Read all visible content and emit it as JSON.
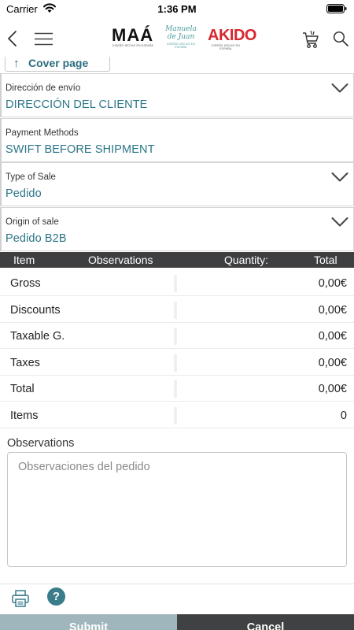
{
  "status_bar": {
    "carrier": "Carrier",
    "time": "1:36 PM"
  },
  "header": {
    "logos": {
      "maa": {
        "text": "MAÁ",
        "sub": "DISEÑO HECHO EN ESPAÑA"
      },
      "manuela": {
        "text_line1": "Manuela",
        "text_line2": "de Juan",
        "sub": "DISEÑO HECHO EN ESPAÑA"
      },
      "akido": {
        "text": "AKIDO",
        "sub": "DISEÑO HECHO EN ESPAÑA"
      }
    },
    "icons": [
      "back-icon",
      "menu-icon",
      "cart-icon",
      "search-icon"
    ]
  },
  "cover_tab": {
    "arrow": "↑",
    "label": "Cover page"
  },
  "fields": [
    {
      "label": "Dirección de envío",
      "value": "DIRECCIÓN DEL CLIENTE",
      "has_dropdown": true
    },
    {
      "label": "Payment Methods",
      "value": "SWIFT BEFORE SHIPMENT",
      "has_dropdown": false
    },
    {
      "label": "Type of Sale",
      "value": "Pedido",
      "has_dropdown": true
    },
    {
      "label": "Origin of sale",
      "value": "Pedido B2B",
      "has_dropdown": true
    }
  ],
  "table": {
    "headers": {
      "item": "Item",
      "observations": "Observations",
      "quantity": "Quantity:",
      "total": "Total"
    }
  },
  "totals": [
    {
      "label": "Gross",
      "value": "0,00€"
    },
    {
      "label": "Discounts",
      "value": "0,00€"
    },
    {
      "label": "Taxable G.",
      "value": "0,00€"
    },
    {
      "label": "Taxes",
      "value": "0,00€"
    },
    {
      "label": "Total",
      "value": "0,00€"
    },
    {
      "label": "Items",
      "value": "0"
    }
  ],
  "observations": {
    "label": "Observations",
    "placeholder": "Observaciones del pedido",
    "value": ""
  },
  "bottom_tools": {
    "help_symbol": "?"
  },
  "actions": {
    "submit": "Submit",
    "cancel": "Cancel"
  },
  "colors": {
    "accent": "#2b7587",
    "header_bar": "#3d3f40",
    "submit_bg": "#9fb6bc",
    "cancel_bg": "#3f4142",
    "akido_red": "#d8262e"
  }
}
